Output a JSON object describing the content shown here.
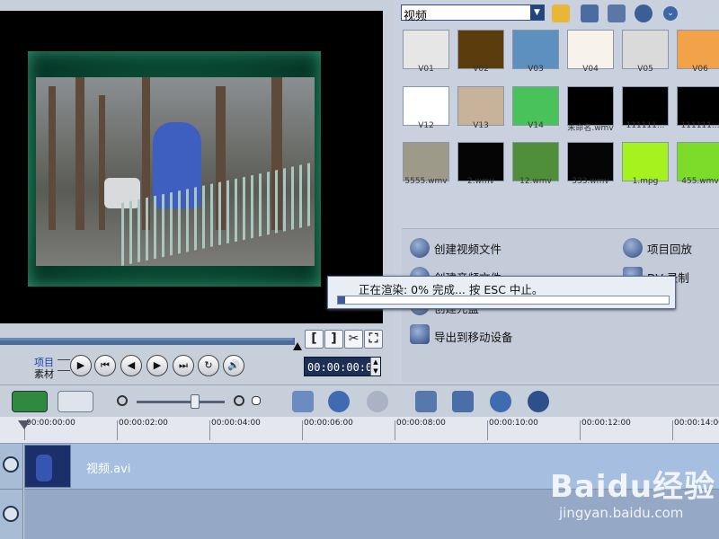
{
  "preview": {
    "mode_project": "项目",
    "mode_clip": "素材",
    "timecode": "00:00:00:00",
    "mark_in": "[",
    "mark_out": "]"
  },
  "library": {
    "dropdown_value": "视频",
    "thumbnails": [
      {
        "label": "V01",
        "color": "#e6e6e6"
      },
      {
        "label": "V02",
        "color": "#5b3d0d"
      },
      {
        "label": "V03",
        "color": "#5d8fbf"
      },
      {
        "label": "V04",
        "color": "#f7f3ea"
      },
      {
        "label": "V05",
        "color": "#dadada"
      },
      {
        "label": "V06",
        "color": "#f2a34a"
      },
      {
        "label": "V12",
        "color": "#ffffff"
      },
      {
        "label": "V13",
        "color": "#c8b39a"
      },
      {
        "label": "V14",
        "color": "#49c25a"
      },
      {
        "label": "未命名.wmv",
        "color": "#000000"
      },
      {
        "label": "111111...",
        "color": "#000000"
      },
      {
        "label": "111111...",
        "color": "#000000"
      },
      {
        "label": "5555.wmv",
        "color": "#9e9a8a"
      },
      {
        "label": "2.wmv",
        "color": "#050505"
      },
      {
        "label": "12.wmv",
        "color": "#4f8f3a"
      },
      {
        "label": "333.wmv",
        "color": "#050505"
      },
      {
        "label": "1.mpg",
        "color": "#a6f21f"
      },
      {
        "label": "455.wmv",
        "color": "#7ddc2a"
      }
    ]
  },
  "share": {
    "create_video": "创建视频文件",
    "create_audio": "创建音频文件",
    "burn_disc": "创建光盘",
    "export_mobile": "导出到移动设备",
    "project_playback": "项目回放",
    "dv_record": "DV 录制"
  },
  "render_dialog": {
    "status": "正在渲染:  0% 完成... 按 ESC 中止。",
    "progress": 0
  },
  "ruler": {
    "ticks": [
      "00:00:00:00",
      "00:00:02:00",
      "00:00:04:00",
      "00:00:06:00",
      "00:00:08:00",
      "00:00:10:00",
      "00:00:12:00",
      "00:00:14:00"
    ]
  },
  "timeline": {
    "clip_name": "视频.avi"
  },
  "watermark": {
    "brand": "Baidu经验",
    "url": "jingyan.baidu.com"
  }
}
